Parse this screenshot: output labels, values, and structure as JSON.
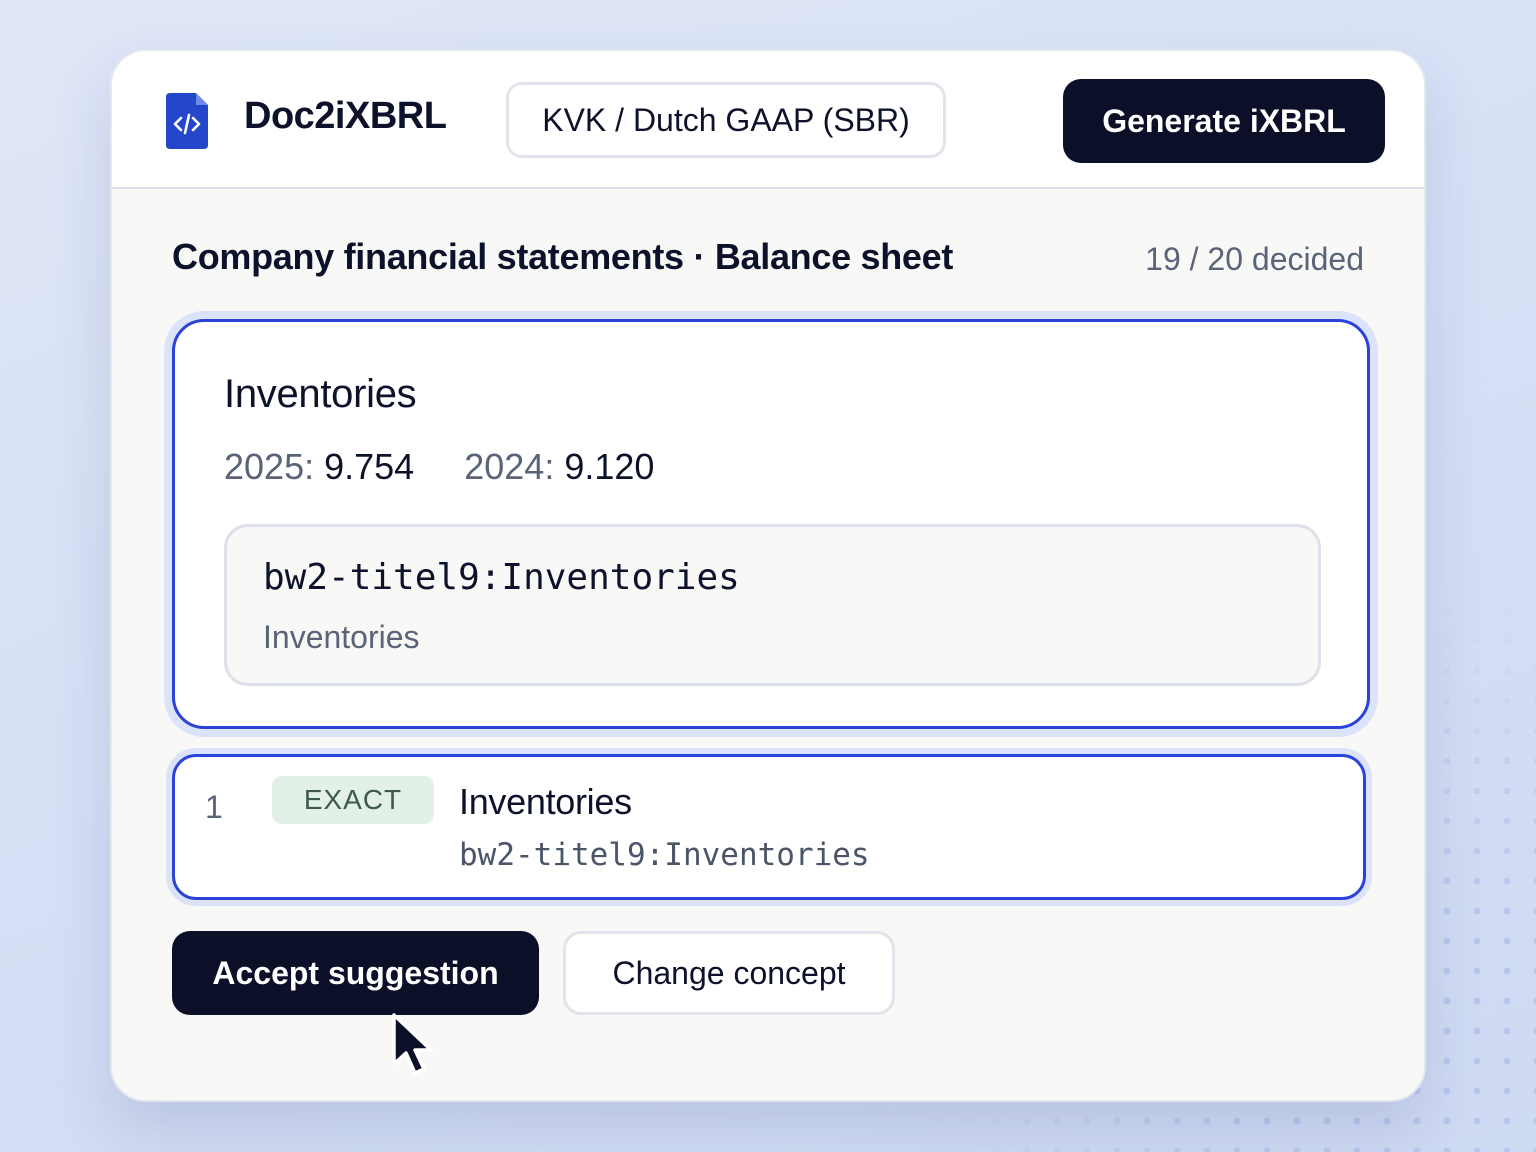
{
  "header": {
    "app_title": "Doc2iXBRL",
    "taxonomy": "KVK / Dutch GAAP (SBR)",
    "generate_label": "Generate iXBRL"
  },
  "section": {
    "title": "Company financial statements · Balance sheet",
    "progress": "19 / 20 decided"
  },
  "concept": {
    "name": "Inventories",
    "years": [
      {
        "label": "2025:",
        "value": "9.754"
      },
      {
        "label": "2024:",
        "value": "9.120"
      }
    ],
    "tag_code": "bw2-titel9:Inventories",
    "tag_label": "Inventories"
  },
  "suggestion": {
    "rank": "1",
    "badge": "EXACT",
    "name": "Inventories",
    "code": "bw2-titel9:Inventories"
  },
  "actions": {
    "accept_label": "Accept suggestion",
    "change_label": "Change concept"
  },
  "colors": {
    "accent": "#2b43d8",
    "dark": "#0b1028",
    "badge_bg": "#e3f0e8"
  },
  "icons": {
    "logo": "code-file-icon",
    "cursor": "mouse-pointer-icon"
  }
}
